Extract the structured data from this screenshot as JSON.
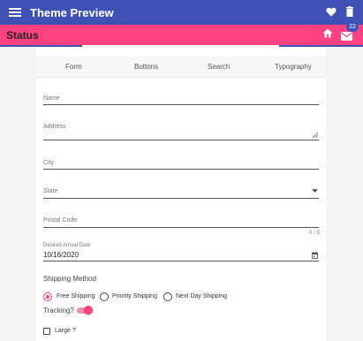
{
  "app": {
    "title": "Theme Preview",
    "status_title": "Status",
    "mail_badge": "22"
  },
  "colors": {
    "primary": "#3f51b5",
    "accent": "#ff4081"
  },
  "tabs": [
    "Form",
    "Buttons",
    "Search",
    "Typography"
  ],
  "form": {
    "name_label": "Name",
    "address_label": "Address",
    "city_label": "City",
    "state_label": "State",
    "postal_label": "Postal Code",
    "postal_counter": "0 / 5",
    "arrival_label": "Desired Arrival Date",
    "arrival_value": "10/16/2020",
    "shipping_title": "Shipping Method",
    "shipping_options": [
      "Free Shipping",
      "Priority Shipping",
      "Next Day Shipping"
    ],
    "tracking_label": "Tracking?",
    "large_label": "Large ?"
  },
  "icons": {
    "menu": "menu-icon",
    "heart": "heart-icon",
    "trash": "trash-icon",
    "home": "home-icon",
    "mail": "mail-icon",
    "dropdown": "chevron-down-icon",
    "calendar": "calendar-icon"
  }
}
